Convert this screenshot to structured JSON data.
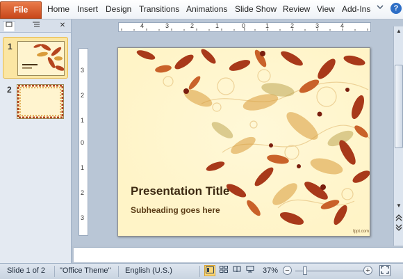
{
  "ribbon": {
    "file_label": "File",
    "tabs": [
      "Home",
      "Insert",
      "Design",
      "Transitions",
      "Animations",
      "Slide Show",
      "Review",
      "View",
      "Add-Ins"
    ],
    "help_glyph": "?"
  },
  "panel": {
    "tab_slides_icon": "slides-icon",
    "tab_outline_icon": "outline-icon",
    "close_glyph": "✕",
    "slides": [
      {
        "number": "1",
        "selected": true
      },
      {
        "number": "2",
        "selected": false
      }
    ]
  },
  "ruler": {
    "h_labels": [
      "4",
      "3",
      "2",
      "1",
      "0",
      "1",
      "2",
      "3",
      "4"
    ],
    "v_labels": [
      "3",
      "2",
      "1",
      "0",
      "1",
      "2",
      "3"
    ]
  },
  "slide": {
    "title": "Presentation Title",
    "subtitle": "Subheading  goes here",
    "credit": "fppt.com"
  },
  "status": {
    "slide_info": "Slide 1 of 2",
    "theme": "\"Office Theme\"",
    "language": "English (U.S.)",
    "zoom": "37%",
    "zoom_fraction": 0.1
  },
  "colors": {
    "file_tab": "#d0552a",
    "slide_bg": "#fff4c7",
    "leaf_dark": "#a8391a",
    "leaf_mid": "#c9622a",
    "leaf_gold": "#d99c3a"
  }
}
